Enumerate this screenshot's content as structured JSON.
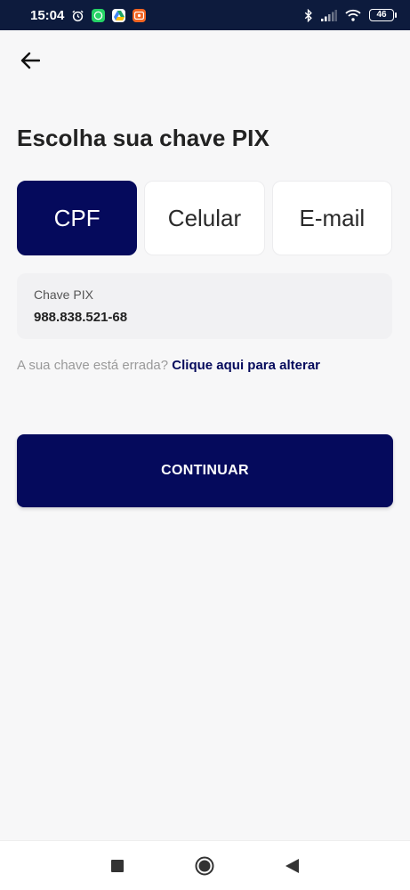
{
  "status_bar": {
    "time": "15:04",
    "battery": "46",
    "icons": [
      "alarm-icon",
      "whatsapp-icon",
      "drive-icon",
      "recorder-icon",
      "bluetooth-icon",
      "signal-icon",
      "wifi-icon",
      "battery-icon"
    ],
    "colors": {
      "background": "#0d1b3d"
    }
  },
  "header": {
    "back_icon": "arrow-left-icon",
    "title": "Escolha sua chave PIX"
  },
  "key_types": [
    {
      "label": "CPF",
      "selected": true
    },
    {
      "label": "Celular",
      "selected": false
    },
    {
      "label": "E-mail",
      "selected": false
    }
  ],
  "key_field": {
    "label": "Chave PIX",
    "value": "988.838.521-68"
  },
  "change_key": {
    "text": "A sua chave está errada?",
    "link": "Clique aqui para alterar"
  },
  "continue_button": {
    "label": "CONTINUAR"
  },
  "nav_bar": {
    "icons": [
      "recent-apps-icon",
      "home-icon",
      "back-icon"
    ]
  },
  "colors": {
    "primary": "#050a5c",
    "background": "#f7f7f8",
    "text": "#222222"
  }
}
